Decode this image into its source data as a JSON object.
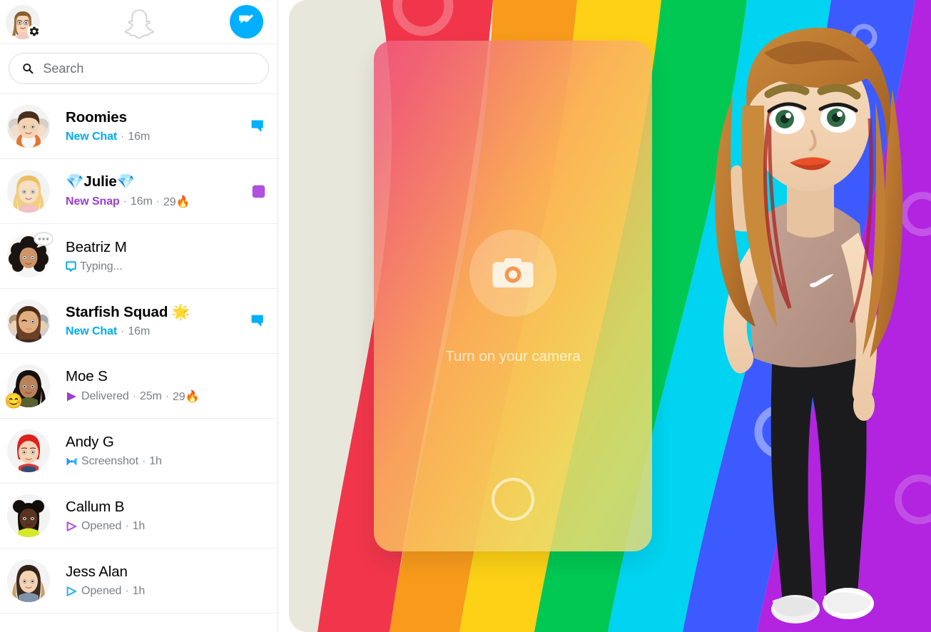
{
  "topbar": {
    "profile_name": "profile-avatar",
    "ghost_logo": "snapchat-ghost-logo",
    "new_chat_label": "New Chat"
  },
  "search": {
    "placeholder": "Search",
    "value": "",
    "icon": "search-icon"
  },
  "chats": [
    {
      "name": "Roomies",
      "avatar_type": "group",
      "status_label": "New Chat",
      "status_color": "blue",
      "time": "16m",
      "streak": "",
      "status_icon": "",
      "badge": "chat-bubble-blue",
      "unread": true,
      "name_bold": true
    },
    {
      "name": "💎Julie💎",
      "avatar_type": "blonde",
      "status_label": "New Snap",
      "status_color": "purple",
      "time": "16m",
      "streak": "29🔥",
      "status_icon": "",
      "badge": "snap-square-purple",
      "unread": true,
      "name_bold": true
    },
    {
      "name": "Beatriz M",
      "avatar_type": "curly",
      "status_label": "",
      "status_color": "",
      "time": "",
      "streak": "",
      "typing_text": "Typing...",
      "status_icon": "typing-chat-icon",
      "badge": "",
      "unread": false,
      "name_bold": false
    },
    {
      "name": "Starfish Squad 🌟",
      "avatar_type": "group2",
      "status_label": "New Chat",
      "status_color": "blue",
      "time": "16m",
      "streak": "",
      "status_icon": "",
      "badge": "chat-bubble-blue",
      "unread": true,
      "name_bold": true
    },
    {
      "name": "Moe S",
      "avatar_type": "dark-hair",
      "status_label": "",
      "status_color": "",
      "plain_text": "Delivered",
      "time": "25m",
      "streak": "29🔥",
      "status_icon": "delivered-snap-icon",
      "emoji_badge": "😊",
      "badge": "",
      "unread": false,
      "name_bold": false
    },
    {
      "name": "Andy G",
      "avatar_type": "redhead",
      "status_label": "",
      "status_color": "",
      "plain_text": "Screenshot",
      "time": "1h",
      "streak": "",
      "status_icon": "screenshot-icon",
      "badge": "",
      "unread": false,
      "name_bold": false
    },
    {
      "name": "Callum B",
      "avatar_type": "buns",
      "status_label": "",
      "status_color": "",
      "plain_text": "Opened",
      "time": "1h",
      "streak": "",
      "status_icon": "opened-snap-icon",
      "badge": "",
      "unread": false,
      "name_bold": false
    },
    {
      "name": "Jess Alan",
      "avatar_type": "straight",
      "status_label": "",
      "status_color": "",
      "plain_text": "Opened",
      "time": "1h",
      "streak": "",
      "status_icon": "opened-chat-icon",
      "badge": "",
      "unread": false,
      "name_bold": false
    }
  ],
  "camera": {
    "prompt": "Turn on your camera",
    "camera_icon": "camera-icon",
    "shutter": "shutter-button"
  },
  "colors": {
    "accent_blue": "#00b0ff",
    "snap_purple": "#a855e0",
    "chat_blue": "#00aaf0",
    "rainbow_red": "#f1364b",
    "rainbow_orange": "#f89b1c",
    "rainbow_yellow": "#fcd116",
    "rainbow_green": "#00c853",
    "rainbow_cyan": "#00d4f0",
    "rainbow_blue": "#3d5afe",
    "rainbow_purple": "#b224e0",
    "panel_bg": "#e8e7dc"
  }
}
